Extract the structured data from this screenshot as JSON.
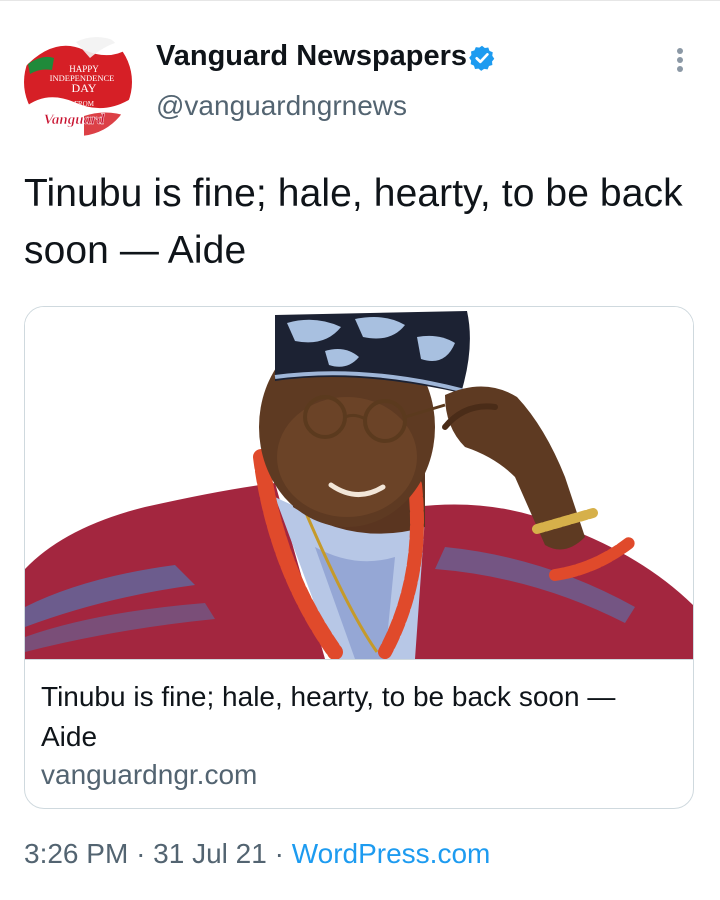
{
  "author": {
    "name": "Vanguard Newspapers",
    "handle": "@vanguardngrnews",
    "verified": true,
    "avatar": {
      "lines": [
        "HAPPY",
        "INDEPENDENCE",
        "DAY",
        "FROM",
        "Vanguard"
      ]
    }
  },
  "tweet": {
    "text": "Tinubu is fine; hale, hearty, to be back soon — Aide"
  },
  "card": {
    "title": "Tinubu is fine; hale, hearty, to be back soon — Aide",
    "domain": "vanguardngr.com"
  },
  "meta": {
    "time": "3:26 PM",
    "separator": "·",
    "date": "31 Jul 21",
    "source": "WordPress.com"
  },
  "icons": {
    "verified": "verified-badge-icon",
    "more": "more-vertical-icon"
  },
  "colors": {
    "accent": "#1d9bf0",
    "secondary_text": "#536471",
    "border": "#cfd9de"
  }
}
